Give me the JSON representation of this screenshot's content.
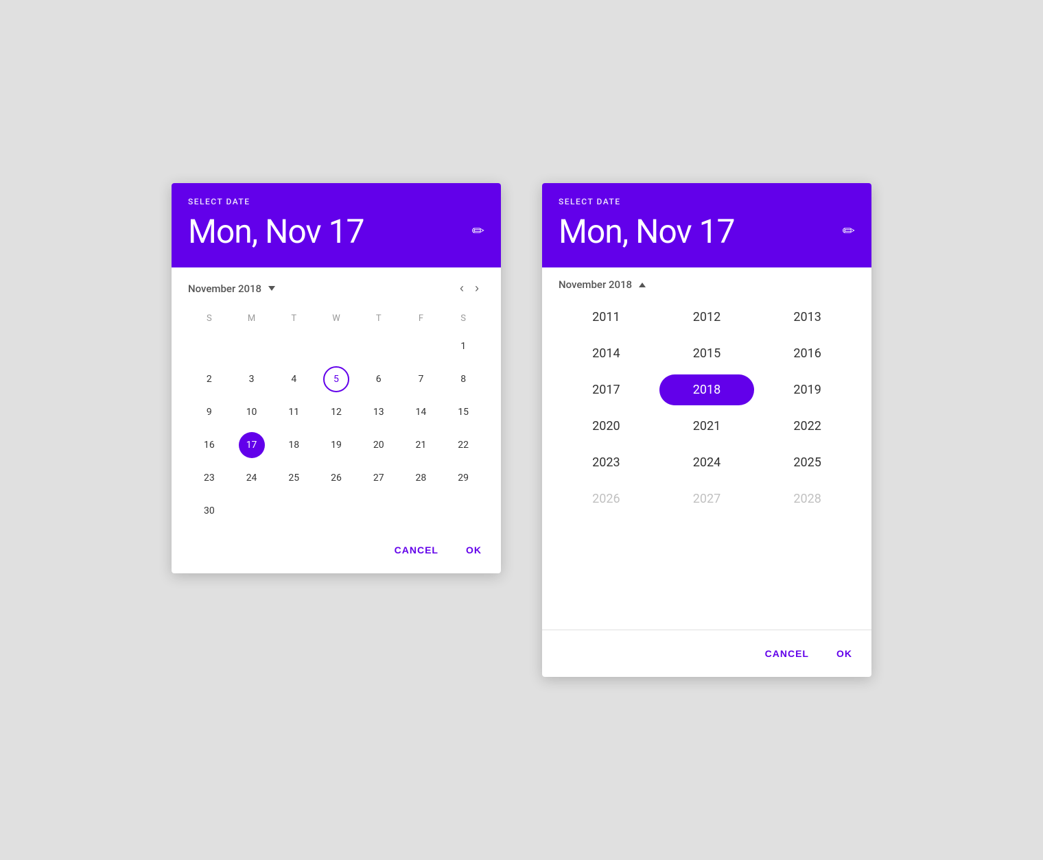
{
  "picker1": {
    "header": {
      "select_date_label": "SELECT DATE",
      "selected_date": "Mon, Nov 17",
      "edit_icon": "✏"
    },
    "month_nav": {
      "month_label": "November 2018",
      "triangle": "down",
      "prev_arrow": "‹",
      "next_arrow": "›"
    },
    "day_names": [
      "S",
      "M",
      "T",
      "W",
      "T",
      "F",
      "S"
    ],
    "days": [
      {
        "day": "",
        "state": "empty"
      },
      {
        "day": "",
        "state": "empty"
      },
      {
        "day": "",
        "state": "empty"
      },
      {
        "day": "",
        "state": "empty"
      },
      {
        "day": "",
        "state": "empty"
      },
      {
        "day": "",
        "state": "empty"
      },
      {
        "day": "1",
        "state": "normal"
      },
      {
        "day": "2",
        "state": "normal"
      },
      {
        "day": "3",
        "state": "normal"
      },
      {
        "day": "4",
        "state": "normal"
      },
      {
        "day": "5",
        "state": "today"
      },
      {
        "day": "6",
        "state": "normal"
      },
      {
        "day": "7",
        "state": "normal"
      },
      {
        "day": "8",
        "state": "normal"
      },
      {
        "day": "9",
        "state": "normal"
      },
      {
        "day": "10",
        "state": "normal"
      },
      {
        "day": "11",
        "state": "normal"
      },
      {
        "day": "12",
        "state": "normal"
      },
      {
        "day": "13",
        "state": "normal"
      },
      {
        "day": "14",
        "state": "normal"
      },
      {
        "day": "15",
        "state": "normal"
      },
      {
        "day": "16",
        "state": "normal"
      },
      {
        "day": "17",
        "state": "selected"
      },
      {
        "day": "18",
        "state": "normal"
      },
      {
        "day": "19",
        "state": "normal"
      },
      {
        "day": "20",
        "state": "normal"
      },
      {
        "day": "21",
        "state": "normal"
      },
      {
        "day": "22",
        "state": "normal"
      },
      {
        "day": "23",
        "state": "normal"
      },
      {
        "day": "24",
        "state": "normal"
      },
      {
        "day": "25",
        "state": "normal"
      },
      {
        "day": "26",
        "state": "normal"
      },
      {
        "day": "27",
        "state": "normal"
      },
      {
        "day": "28",
        "state": "normal"
      },
      {
        "day": "29",
        "state": "normal"
      },
      {
        "day": "30",
        "state": "normal"
      },
      {
        "day": "",
        "state": "empty"
      },
      {
        "day": "",
        "state": "empty"
      },
      {
        "day": "",
        "state": "empty"
      },
      {
        "day": "",
        "state": "empty"
      },
      {
        "day": "",
        "state": "empty"
      },
      {
        "day": "",
        "state": "empty"
      }
    ],
    "actions": {
      "cancel": "CANCEL",
      "ok": "OK"
    }
  },
  "picker2": {
    "header": {
      "select_date_label": "SELECT DATE",
      "selected_date": "Mon, Nov 17",
      "edit_icon": "✏"
    },
    "month_nav": {
      "month_label": "November 2018",
      "triangle": "up"
    },
    "years": [
      {
        "year": "2011",
        "state": "normal"
      },
      {
        "year": "2012",
        "state": "normal"
      },
      {
        "year": "2013",
        "state": "normal"
      },
      {
        "year": "2014",
        "state": "normal"
      },
      {
        "year": "2015",
        "state": "normal"
      },
      {
        "year": "2016",
        "state": "normal"
      },
      {
        "year": "2017",
        "state": "normal"
      },
      {
        "year": "2018",
        "state": "selected"
      },
      {
        "year": "2019",
        "state": "normal"
      },
      {
        "year": "2020",
        "state": "normal"
      },
      {
        "year": "2021",
        "state": "normal"
      },
      {
        "year": "2022",
        "state": "normal"
      },
      {
        "year": "2023",
        "state": "normal"
      },
      {
        "year": "2024",
        "state": "normal"
      },
      {
        "year": "2025",
        "state": "normal"
      },
      {
        "year": "2026",
        "state": "faded"
      },
      {
        "year": "2027",
        "state": "faded"
      },
      {
        "year": "2028",
        "state": "faded"
      }
    ],
    "actions": {
      "cancel": "CANCEL",
      "ok": "OK"
    }
  }
}
